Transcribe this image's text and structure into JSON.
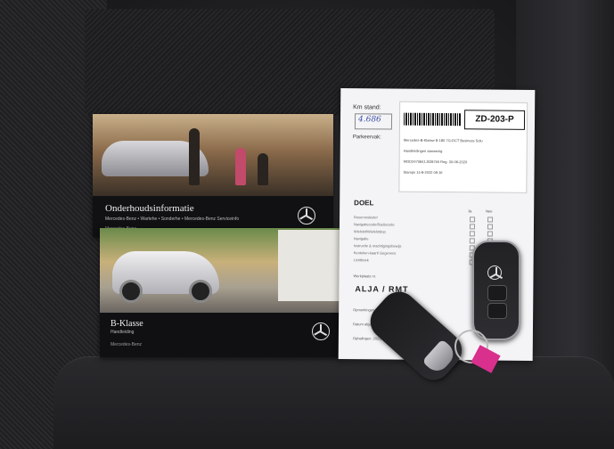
{
  "booklet_service": {
    "title": "Onderhoudsinformatie",
    "subtitle": "Mercedes-Benz • Wartehe • Sonderhe • Mercedes-Benz Serviceinfo",
    "brand": "Mercedes-Benz"
  },
  "booklet_model": {
    "title": "B-Klasse",
    "subtitle": "Handleiding",
    "brand": "Mercedes-Benz"
  },
  "service_sheet": {
    "km_label": "Km stand:",
    "km_value": "4.686",
    "plate": "ZD-203-P",
    "parkeervak_label": "Parkeervak:",
    "sticker_lines": [
      "Mercedes-B-Klasse B 180 7G-DCT Business Solu",
      "Handleidingen aanwezig",
      "WDD2470841J028760     Reg. 30-09-2020",
      "Stamps 14-8-2022 09:16"
    ],
    "doel_label": "DOEL",
    "col_ja": "Ja",
    "col_nee": "Nee",
    "rows": [
      "Reservesleutel",
      "Navigatiecode/Radiocode",
      "Wielslot/Wielslotdop",
      "Navigatie",
      "Instructie & machtigingsbewijs",
      "Kenteken-kaart/ Gegevens",
      "Lichtboek"
    ],
    "gereed_label": "Werkplaats nr.",
    "name_stamp": "ALJA / RMT",
    "footer_lines": [
      "Opmerkingen werkplaats:",
      "Datum afgeleverd:",
      "Ophalingen: 2022/7/1"
    ]
  }
}
